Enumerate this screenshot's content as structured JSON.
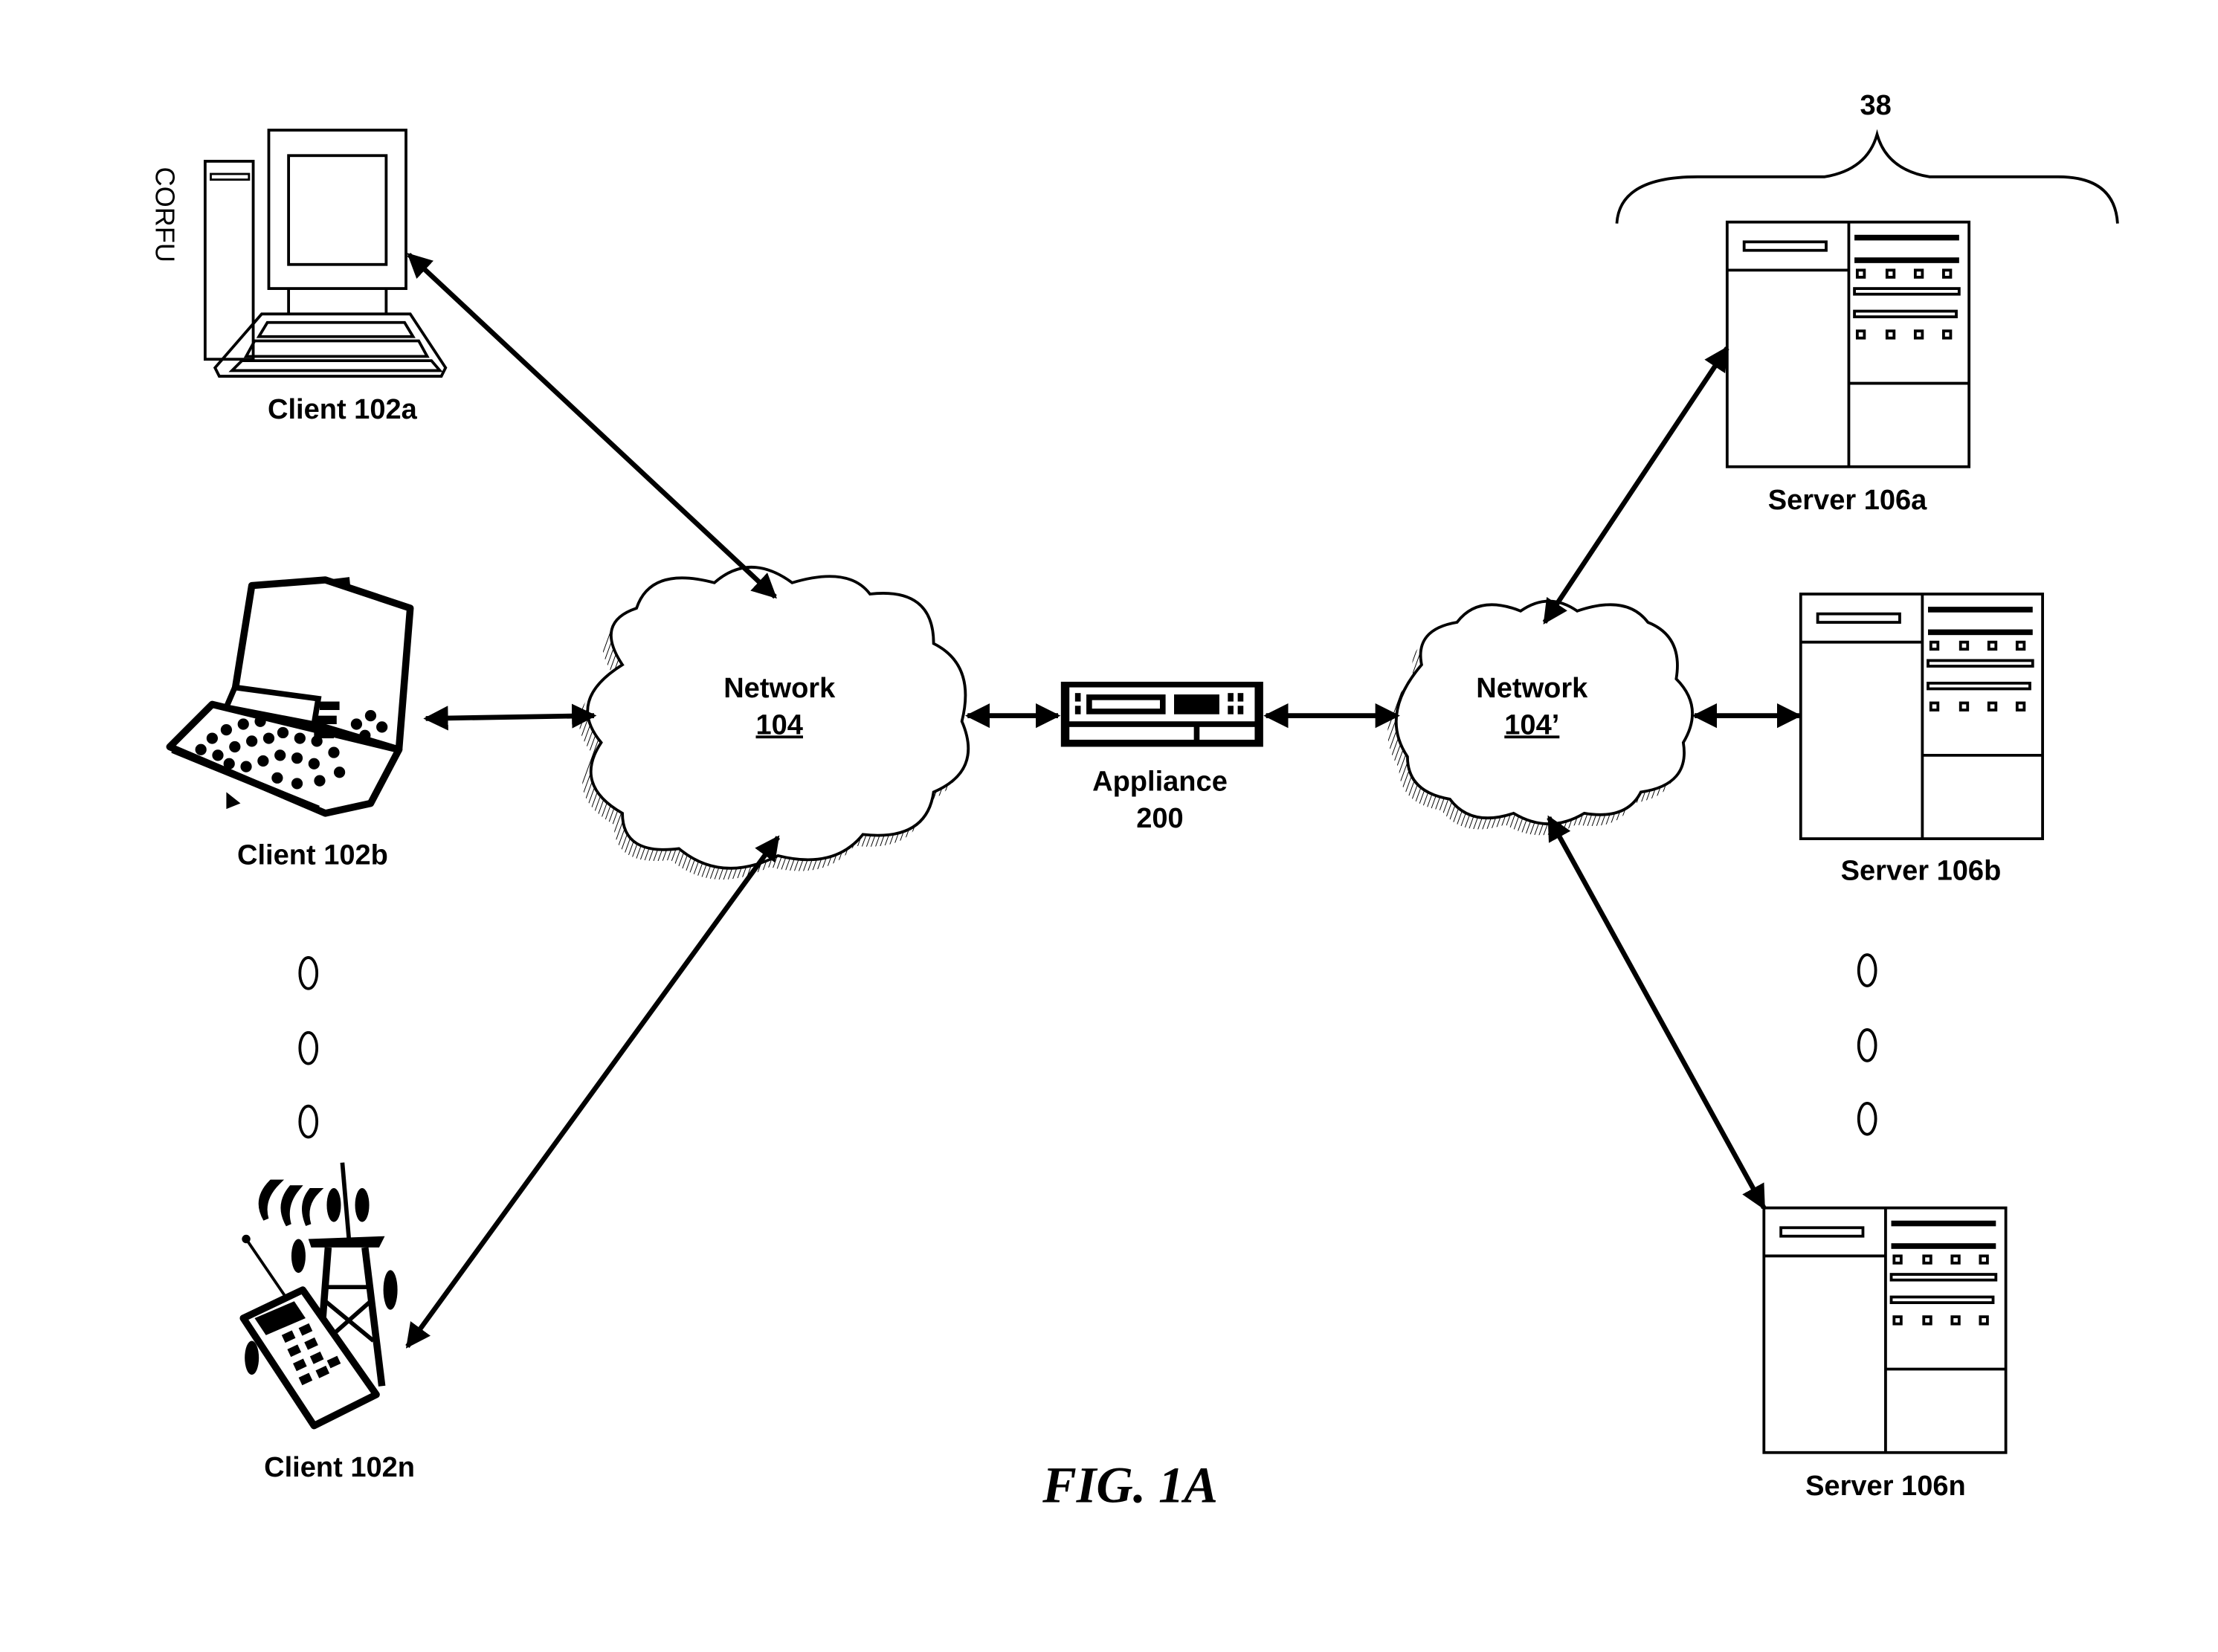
{
  "figure": {
    "caption": "FIG. 1A",
    "group_label": "38"
  },
  "clients": [
    {
      "label": "Client 102a",
      "type": "desktop",
      "brand": "CORFU"
    },
    {
      "label": "Client 102b",
      "type": "laptop"
    },
    {
      "label": "Client 102n",
      "type": "mobile-phone"
    }
  ],
  "networks": [
    {
      "name": "Network",
      "ref": "104"
    },
    {
      "name": "Network",
      "ref": "104’"
    }
  ],
  "appliance": {
    "name": "Appliance",
    "ref": "200"
  },
  "servers": [
    {
      "label": "Server 106a"
    },
    {
      "label": "Server 106b"
    },
    {
      "label": "Server 106n"
    }
  ],
  "ellipsis_glyph": "0",
  "colors": {
    "ink": "#000000",
    "paper": "#ffffff"
  }
}
